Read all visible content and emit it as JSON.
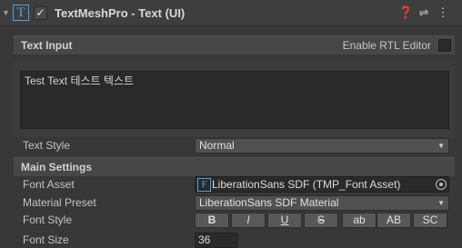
{
  "component": {
    "title": "TextMeshPro - Text (UI)",
    "enabled_check": "✓",
    "tmp_icon_glyph": "T",
    "header_icons": [
      {
        "name": "help-icon",
        "glyph": "❓"
      },
      {
        "name": "presets-icon",
        "glyph": "⇌"
      },
      {
        "name": "context-menu-icon",
        "glyph": "⋮"
      }
    ]
  },
  "text_input": {
    "section_title": "Text Input",
    "rtl_label": "Enable RTL Editor",
    "rtl_enabled": false,
    "text_value": "Test Text 테스트 텍스트"
  },
  "text_style": {
    "label": "Text Style",
    "value": "Normal"
  },
  "main_settings": {
    "section_title": "Main Settings",
    "font_asset_label": "Font Asset",
    "font_asset_icon": "F",
    "font_asset_value": "LiberationSans SDF (TMP_Font Asset)",
    "material_preset_label": "Material Preset",
    "material_preset_value": "LiberationSans SDF Material",
    "font_style_label": "Font Style",
    "font_style_buttons": [
      "B",
      "I",
      "U",
      "S",
      "ab",
      "AB",
      "SC"
    ],
    "font_size_label": "Font Size",
    "font_size_value": "36"
  },
  "colors": {
    "background": "#383838",
    "accent_icon": "#4aa3df",
    "field_bg": "#2a2a2a",
    "button_bg": "#585858"
  }
}
